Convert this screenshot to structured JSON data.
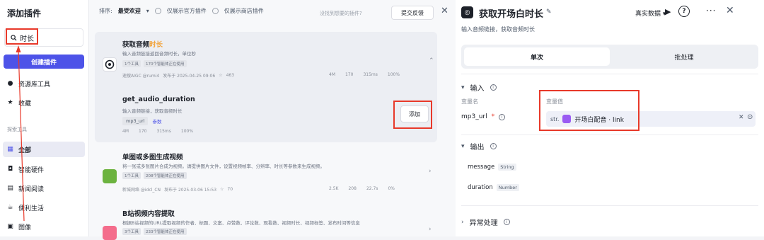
{
  "sidebar": {
    "title": "添加插件",
    "search_value": "时长",
    "create_label": "创建插件",
    "items_top": [
      {
        "label": "资源库工具",
        "icon": "person-icon"
      },
      {
        "label": "收藏",
        "icon": "star-icon"
      }
    ],
    "section_label": "探索工具",
    "items_bottom": [
      {
        "label": "全部",
        "icon": "grid-icon"
      },
      {
        "label": "智能硬件",
        "icon": "device-icon"
      },
      {
        "label": "新闻阅读",
        "icon": "newspaper-icon"
      },
      {
        "label": "便利生活",
        "icon": "cup-icon"
      },
      {
        "label": "图像",
        "icon": "image-icon"
      }
    ]
  },
  "middle": {
    "sort_label": "排序:",
    "sort_value": "最受欢迎",
    "filter_official": "仅展示官方插件",
    "filter_store": "仅展示商店插件",
    "hint": "没找到想要的插件?",
    "feedback_label": "提交反馈",
    "cards": [
      {
        "title_prefix": "获取音频",
        "title_highlight": "时长",
        "desc": "输入音频链接返回音频时长，单位秒",
        "tags": [
          "1个工具",
          "170个智能体正在使用"
        ],
        "author": "速搜AIGC @rumi4",
        "published": "发布于 2025-04-25 09:06",
        "stars": "463",
        "stats": [
          "4M",
          "170",
          "315ms",
          "100%"
        ],
        "tool": {
          "name": "get_audio_duration",
          "desc": "输入音频链接，获取音频时长",
          "param": "mp3_url",
          "param_link": "参数",
          "stats": [
            "4M",
            "170",
            "315ms",
            "100%"
          ],
          "add_label": "添加"
        }
      },
      {
        "title": "单图或多图生成视频",
        "desc": "将一张或多张图片合成为视频。请提供图片文件，设置视频帧率、分辨率、时长等参数来生成视频。",
        "tags": [
          "1个工具",
          "208个智能体正在使用"
        ],
        "author": "新城网络 @idcl_CN",
        "published": "发布于 2025-03-06 15:53",
        "stars": "70",
        "stats": [
          "2.5K",
          "208",
          "22.7s",
          "0%"
        ]
      },
      {
        "title": "B站视频内容提取",
        "desc": "根据B站视频的URL提取视频的作者、标题、文案、点赞数、评论数、观看数、视频时长、视频标签、发布时间等信息",
        "tags": [
          "3个工具",
          "233个智能体正在使用"
        ]
      }
    ]
  },
  "right": {
    "title": "获取开场白时长",
    "desc": "输入音频链接，获取音频时长",
    "data_mode": "真实数据",
    "tabs": [
      "单次",
      "批处理"
    ],
    "input_section": "输入",
    "col_var_name": "变量名",
    "col_var_value": "变量值",
    "var_name": "mp3_url",
    "var_type": "str.",
    "var_value": "开场白配音 · link",
    "output_section": "输出",
    "outputs": [
      {
        "name": "message",
        "type": "String"
      },
      {
        "name": "duration",
        "type": "Number"
      }
    ],
    "error_section": "异常处理"
  },
  "colors": {
    "accent": "#4d53e8",
    "highlight_box": "#e8392a",
    "title_highlight": "#f2a33a"
  }
}
